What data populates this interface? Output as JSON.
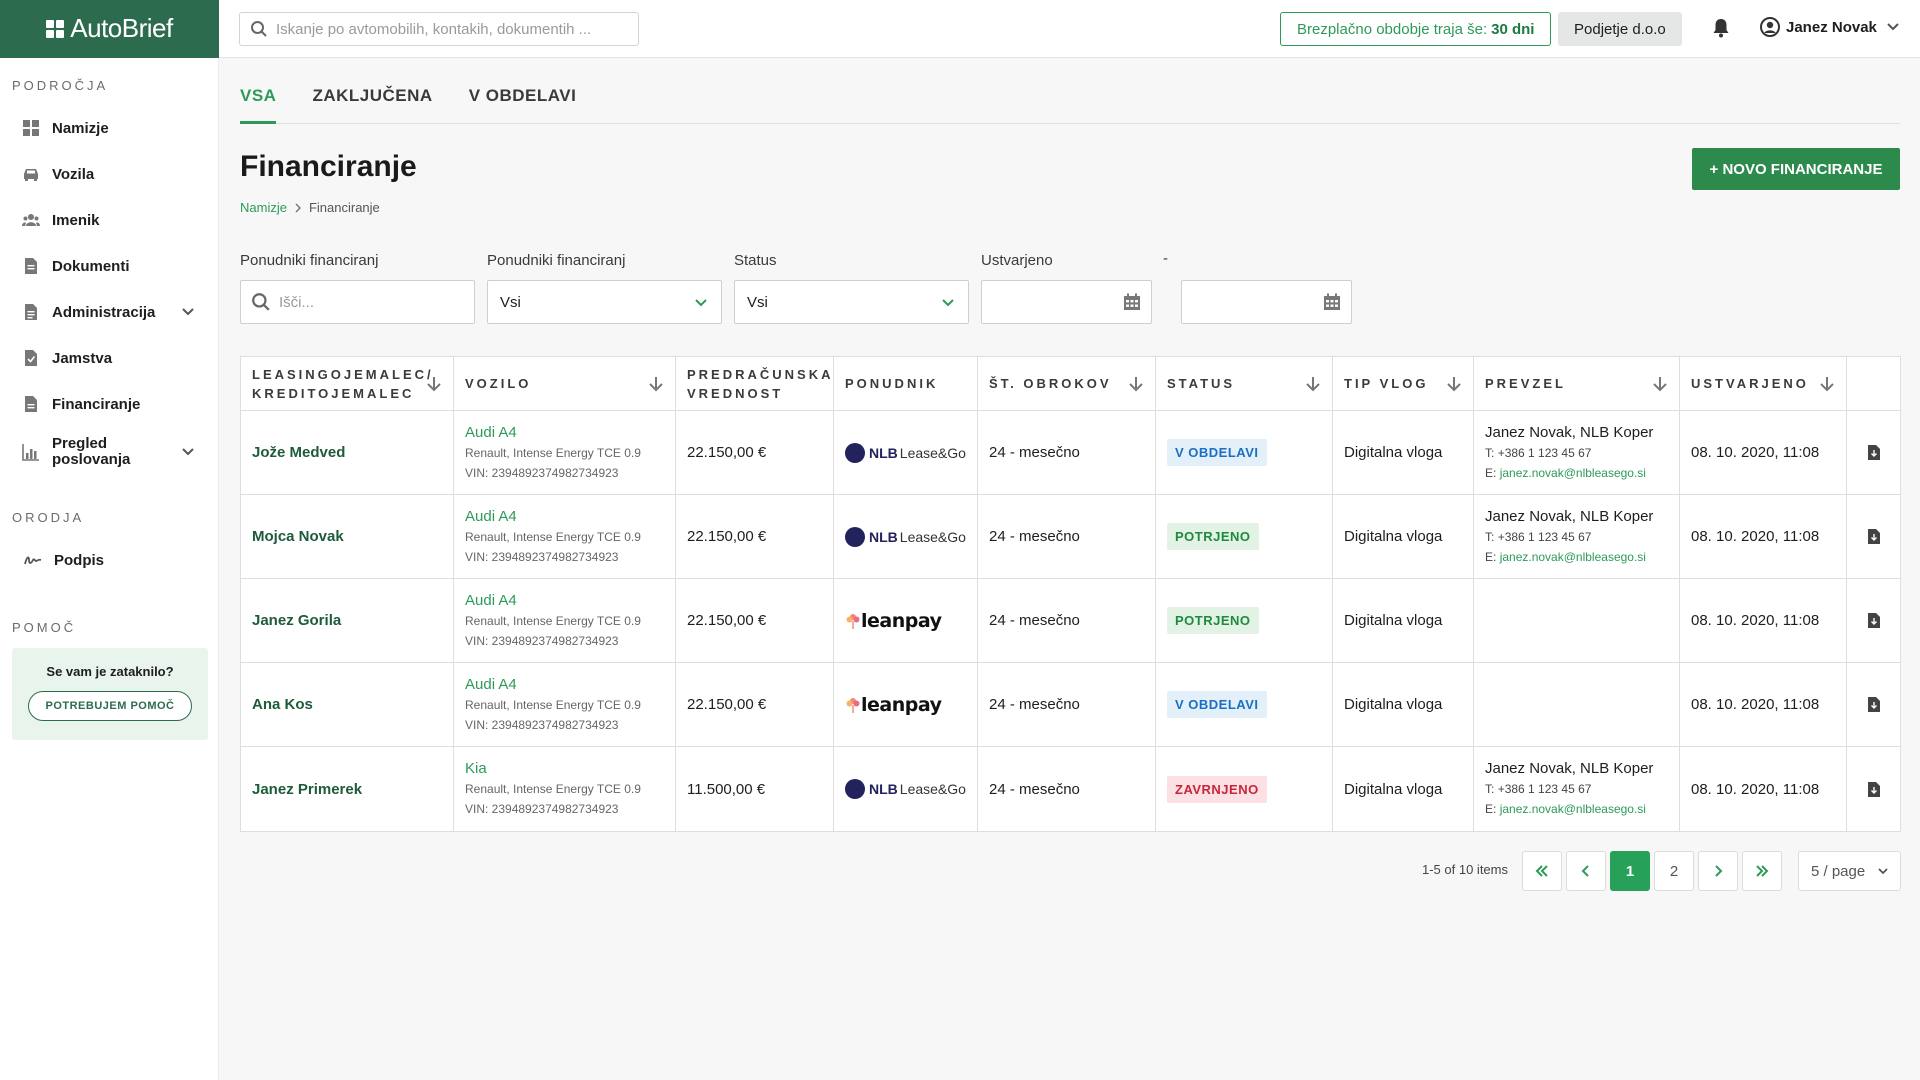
{
  "app": {
    "name": "AutoBrief"
  },
  "header": {
    "search_placeholder": "Iskanje po avtomobilih, kontakih, dokumentih ...",
    "trial_text": "Brezplačno obdobje traja še:",
    "trial_days": "30 dni",
    "company": "Podjetje d.o.o",
    "user": "Janez Novak"
  },
  "sidebar": {
    "section_areas": "PODROČJA",
    "items": [
      {
        "label": "Namizje",
        "icon": "dashboard-icon"
      },
      {
        "label": "Vozila",
        "icon": "car-icon"
      },
      {
        "label": "Imenik",
        "icon": "contacts-icon"
      },
      {
        "label": "Dokumenti",
        "icon": "document-icon"
      },
      {
        "label": "Administracija",
        "icon": "admin-document-icon"
      },
      {
        "label": "Jamstva",
        "icon": "warranty-icon"
      },
      {
        "label": "Financiranje",
        "icon": "finance-document-icon"
      },
      {
        "label": "Pregled poslovanja",
        "icon": "chart-icon"
      }
    ],
    "section_tools": "ORODJA",
    "tools": [
      {
        "label": "Podpis",
        "icon": "signature-icon"
      }
    ],
    "section_help": "POMOČ",
    "help_title": "Se vam je zataknilo?",
    "help_button": "POTREBUJEM POMOČ"
  },
  "tabs": [
    {
      "label": "VSA",
      "active": true
    },
    {
      "label": "ZAKLJUČENA",
      "active": false
    },
    {
      "label": "V OBDELAVI",
      "active": false
    }
  ],
  "page": {
    "title": "Financiranje",
    "breadcrumb": [
      "Namizje",
      "Financiranje"
    ],
    "new_button": "+ NOVO FINANCIRANJE"
  },
  "filters": {
    "f1_label": "Ponudniki financiranj",
    "f1_placeholder": "Išči...",
    "f2_label": "Ponudniki financiranj",
    "f2_value": "Vsi",
    "f3_label": "Status",
    "f3_value": "Vsi",
    "f4_label": "Ustvarjeno",
    "f4_sep": "-"
  },
  "table": {
    "headers": [
      "LEASINGOJEMALEC/ KREDITOJEMALEC",
      "VOZILO",
      "PREDRAČUNSKA VREDNOST",
      "PONUDNIK",
      "ŠT. OBROKOV",
      "STATUS",
      "TIP VLOG",
      "PREVZEL",
      "USTVARJENO"
    ],
    "rows": [
      {
        "name": "Jože Medved",
        "model": "Audi A4",
        "details": "Renault, Intense Energy TCE 0.9",
        "vin": "VIN: 2394892374982734923",
        "value": "22.150,00 €",
        "provider_bold": "NLB",
        "provider_rest": "Lease&Go",
        "installments": "24 - mesečno",
        "status": "V OBDELAVI",
        "status_color": "#1b6fc2",
        "type": "Digitalna vloga",
        "taken_name": "Janez Novak, NLB Koper",
        "taken_phone_label": "T:",
        "taken_phone": "+386 1 123 45 67",
        "taken_email_label": "E:",
        "taken_email": "janez.novak@nlbleasego.si",
        "created": "08. 10. 2020, 11:08"
      },
      {
        "name": "Mojca Novak",
        "model": "Audi A4",
        "details": "Renault, Intense Energy TCE 0.9",
        "vin": "VIN: 2394892374982734923",
        "value": "22.150,00 €",
        "provider_bold": "NLB",
        "provider_rest": "Lease&Go",
        "installments": "24 - mesečno",
        "status": "POTRJENO",
        "status_color": "#1f8a3d",
        "type": "Digitalna vloga",
        "taken_name": "Janez Novak, NLB Koper",
        "taken_phone_label": "T:",
        "taken_phone": "+386 1 123 45 67",
        "taken_email_label": "E:",
        "taken_email": "janez.novak@nlbleasego.si",
        "created": "08. 10. 2020, 11:08"
      },
      {
        "name": "Janez Gorila",
        "model": "Audi A4",
        "details": "Renault, Intense Energy TCE 0.9",
        "vin": "VIN: 2394892374982734923",
        "value": "22.150,00 €",
        "provider_text": "leanpay",
        "installments": "24 - mesečno",
        "status": "POTRJENO",
        "status_color": "#1f8a3d",
        "type": "Digitalna vloga",
        "created": "08. 10. 2020, 11:08"
      },
      {
        "name": "Ana Kos",
        "model": "Audi A4",
        "details": "Renault, Intense Energy TCE 0.9",
        "vin": "VIN: 2394892374982734923",
        "value": "22.150,00 €",
        "provider_text": "leanpay",
        "installments": "24 - mesečno",
        "status": "V OBDELAVI",
        "status_color": "#1b6fc2",
        "type": "Digitalna vloga",
        "created": "08. 10. 2020, 11:08"
      },
      {
        "name": "Janez Primerek",
        "model": "Kia",
        "details": "Renault, Intense Energy TCE 0.9",
        "vin": "VIN: 2394892374982734923",
        "value": "11.500,00 €",
        "provider_bold": "NLB",
        "provider_rest": "Lease&Go",
        "installments": "24 - mesečno",
        "status": "ZAVRNJENO",
        "status_color": "#c8253a",
        "type": "Digitalna vloga",
        "taken_name": "Janez Novak, NLB Koper",
        "taken_phone_label": "T:",
        "taken_phone": "+386 1 123 45 67",
        "taken_email_label": "E:",
        "taken_email": "janez.novak@nlbleasego.si",
        "created": "08. 10. 2020, 11:08"
      }
    ]
  },
  "pagination": {
    "info": "1-5 of 10 items",
    "pages": [
      "1",
      "2"
    ],
    "current": "1",
    "page_size": "5 / page"
  },
  "colors": {
    "brand": "#2d6b4f",
    "accent": "#2e9a59",
    "primary_button": "#2d8a4d"
  }
}
